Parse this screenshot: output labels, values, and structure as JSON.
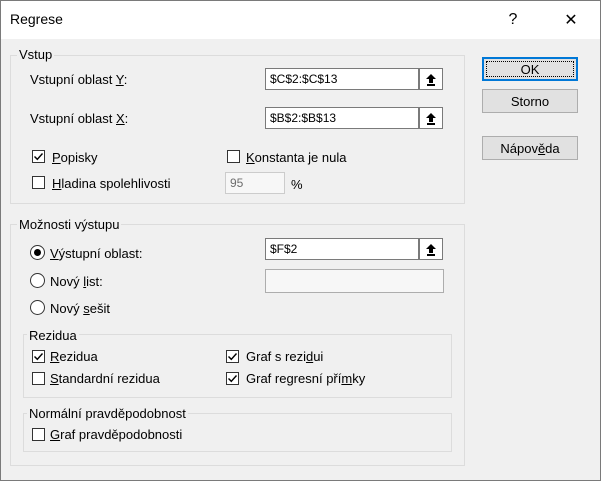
{
  "window": {
    "title": "Regrese",
    "help_glyph": "?",
    "close_glyph": "✕"
  },
  "input": {
    "legend": "Vstup",
    "y_range": {
      "label_before": "Vstupní oblast ",
      "mnemonic": "Y",
      "label_after": ":",
      "value": "$C$2:$C$13"
    },
    "x_range": {
      "label_before": "Vstupní oblast ",
      "mnemonic": "X",
      "label_after": ":",
      "value": "$B$2:$B$13"
    },
    "labels": {
      "mnemonic": "P",
      "rest": "opisky",
      "checked": true
    },
    "constant_zero": {
      "mnemonic": "K",
      "rest": "onstanta je nula",
      "checked": false
    },
    "confidence": {
      "mnemonic": "H",
      "rest": "ladina spolehlivosti",
      "checked": false,
      "value": "95",
      "unit": "%"
    }
  },
  "output": {
    "legend": "Možnosti výstupu",
    "output_range": {
      "before": "",
      "mnemonic": "V",
      "rest": "ýstupní oblast:",
      "selected": true,
      "value": "$F$2"
    },
    "new_sheet": {
      "before": "Nový ",
      "mnemonic": "l",
      "rest": "ist:",
      "selected": false,
      "value": ""
    },
    "new_workbook": {
      "before": "Nový ",
      "mnemonic": "s",
      "rest": "ešit",
      "selected": false
    }
  },
  "residuals": {
    "legend": "Rezidua",
    "residuals": {
      "before": "",
      "mnemonic": "R",
      "rest": "ezidua",
      "checked": true
    },
    "std_residuals": {
      "before": "",
      "mnemonic": "S",
      "rest": "tandardní rezidua",
      "checked": false
    },
    "residual_plot": {
      "before": "Graf s rezi",
      "mnemonic": "d",
      "rest": "ui",
      "checked": true
    },
    "line_fit_plot": {
      "before": "Graf regresní pří",
      "mnemonic": "m",
      "rest": "ky",
      "checked": true
    }
  },
  "normal_prob": {
    "legend": "Normální pravděpodobnost",
    "plot": {
      "before": "",
      "mnemonic": "G",
      "rest": "raf pravděpodobnosti",
      "checked": false
    }
  },
  "buttons": {
    "ok": "OK",
    "cancel": "Storno",
    "help": {
      "before": "Nápov",
      "mnemonic": "ě",
      "rest": "da"
    }
  },
  "colors": {
    "accent": "#0078d7",
    "background": "#f0f0f0"
  }
}
